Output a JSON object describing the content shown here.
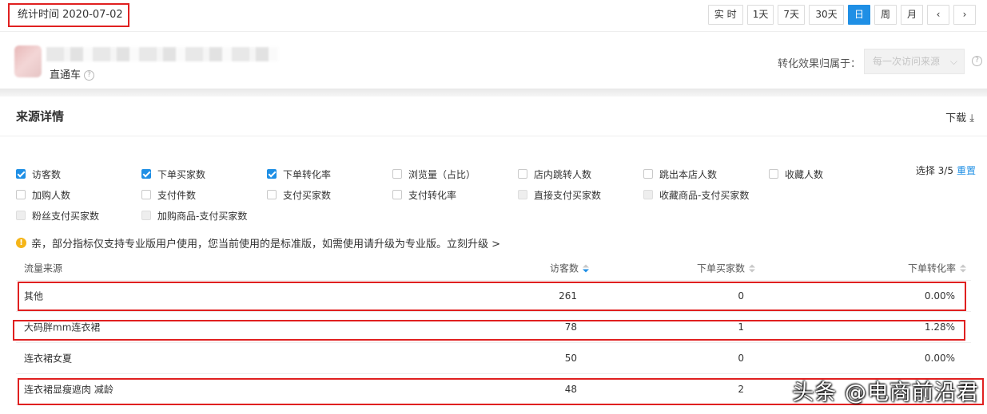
{
  "header": {
    "stat_time": "统计时间 2020-07-02",
    "ranges": [
      {
        "label": "实 时",
        "active": false
      },
      {
        "label": "1天",
        "active": false
      },
      {
        "label": "7天",
        "active": false
      },
      {
        "label": "30天",
        "active": false
      },
      {
        "label": "日",
        "active": true
      },
      {
        "label": "周",
        "active": false
      },
      {
        "label": "月",
        "active": false
      }
    ],
    "prev_icon": "‹",
    "next_icon": "›"
  },
  "shop": {
    "name": "直通车",
    "help_icon": "?",
    "attribution_label": "转化效果归属于：",
    "attribution_value": "每一次访问来源",
    "chevron_icon": "⌵"
  },
  "section": {
    "title": "来源详情",
    "download_label": "下载",
    "download_icon": "⤓"
  },
  "metrics": {
    "selected_text": "选择 3/5",
    "reset_label": "重置",
    "rows": [
      [
        {
          "label": "访客数",
          "state": "on"
        },
        {
          "label": "下单买家数",
          "state": "on"
        },
        {
          "label": "下单转化率",
          "state": "on"
        },
        {
          "label": "浏览量（占比）",
          "state": "off"
        },
        {
          "label": "店内跳转人数",
          "state": "off"
        },
        {
          "label": "跳出本店人数",
          "state": "off"
        },
        {
          "label": "收藏人数",
          "state": "off"
        }
      ],
      [
        {
          "label": "加购人数",
          "state": "off"
        },
        {
          "label": "支付件数",
          "state": "off"
        },
        {
          "label": "支付买家数",
          "state": "off"
        },
        {
          "label": "支付转化率",
          "state": "off"
        },
        {
          "label": "直接支付买家数",
          "state": "dis"
        },
        {
          "label": "收藏商品-支付买家数",
          "state": "dis"
        }
      ],
      [
        {
          "label": "粉丝支付买家数",
          "state": "dis"
        },
        {
          "label": "加购商品-支付买家数",
          "state": "dis"
        }
      ]
    ]
  },
  "notice": {
    "icon": "!",
    "text": "亲，部分指标仅支持专业版用户使用，您当前使用的是标准版，如需使用请升级为专业版。立刻升级 >"
  },
  "table": {
    "columns": [
      "流量来源",
      "访客数",
      "下单买家数",
      "下单转化率"
    ],
    "rows": [
      [
        "其他",
        "261",
        "0",
        "0.00%"
      ],
      [
        "大码胖mm连衣裙",
        "78",
        "1",
        "1.28%"
      ],
      [
        "连衣裙女夏",
        "50",
        "0",
        "0.00%"
      ],
      [
        "连衣裙显瘦遮肉 减龄",
        "48",
        "2",
        ""
      ]
    ]
  },
  "watermark": "头条 @电商前沿君",
  "colors": {
    "accent": "#1f8fe5",
    "highlight": "#e02020",
    "warning": "#f5b518"
  }
}
